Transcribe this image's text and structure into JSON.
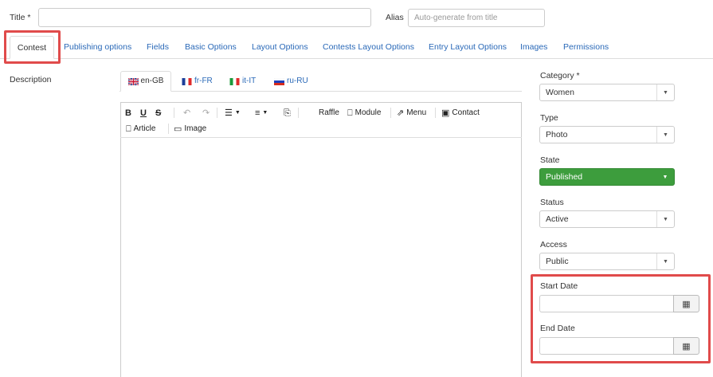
{
  "header": {
    "title_label": "Title",
    "required_mark": "*",
    "title_value": "",
    "alias_label": "Alias",
    "alias_placeholder": "Auto-generate from title"
  },
  "tabs": [
    {
      "label": "Contest",
      "active": true
    },
    {
      "label": "Publishing options"
    },
    {
      "label": "Fields"
    },
    {
      "label": "Basic Options"
    },
    {
      "label": "Layout Options"
    },
    {
      "label": "Contests Layout Options"
    },
    {
      "label": "Entry Layout Options"
    },
    {
      "label": "Images"
    },
    {
      "label": "Permissions"
    }
  ],
  "description_label": "Description",
  "languages": [
    {
      "code": "en-GB",
      "active": true
    },
    {
      "code": "fr-FR"
    },
    {
      "code": "it-IT"
    },
    {
      "code": "ru-RU"
    }
  ],
  "toolbar": {
    "bold": "B",
    "underline": "U",
    "strike": "S",
    "raffle": "Raffle",
    "module": "Module",
    "menu": "Menu",
    "contact": "Contact",
    "article": "Article",
    "image": "Image"
  },
  "sidebar": {
    "category": {
      "label": "Category",
      "value": "Women"
    },
    "type": {
      "label": "Type",
      "value": "Photo"
    },
    "state": {
      "label": "State",
      "value": "Published",
      "color": "#3d9d3d"
    },
    "status": {
      "label": "Status",
      "value": "Active"
    },
    "access": {
      "label": "Access",
      "value": "Public"
    },
    "start_date": {
      "label": "Start Date",
      "value": ""
    },
    "end_date": {
      "label": "End Date",
      "value": ""
    }
  },
  "colors": {
    "highlight": "#e04b4b",
    "link": "#2a69b8"
  }
}
